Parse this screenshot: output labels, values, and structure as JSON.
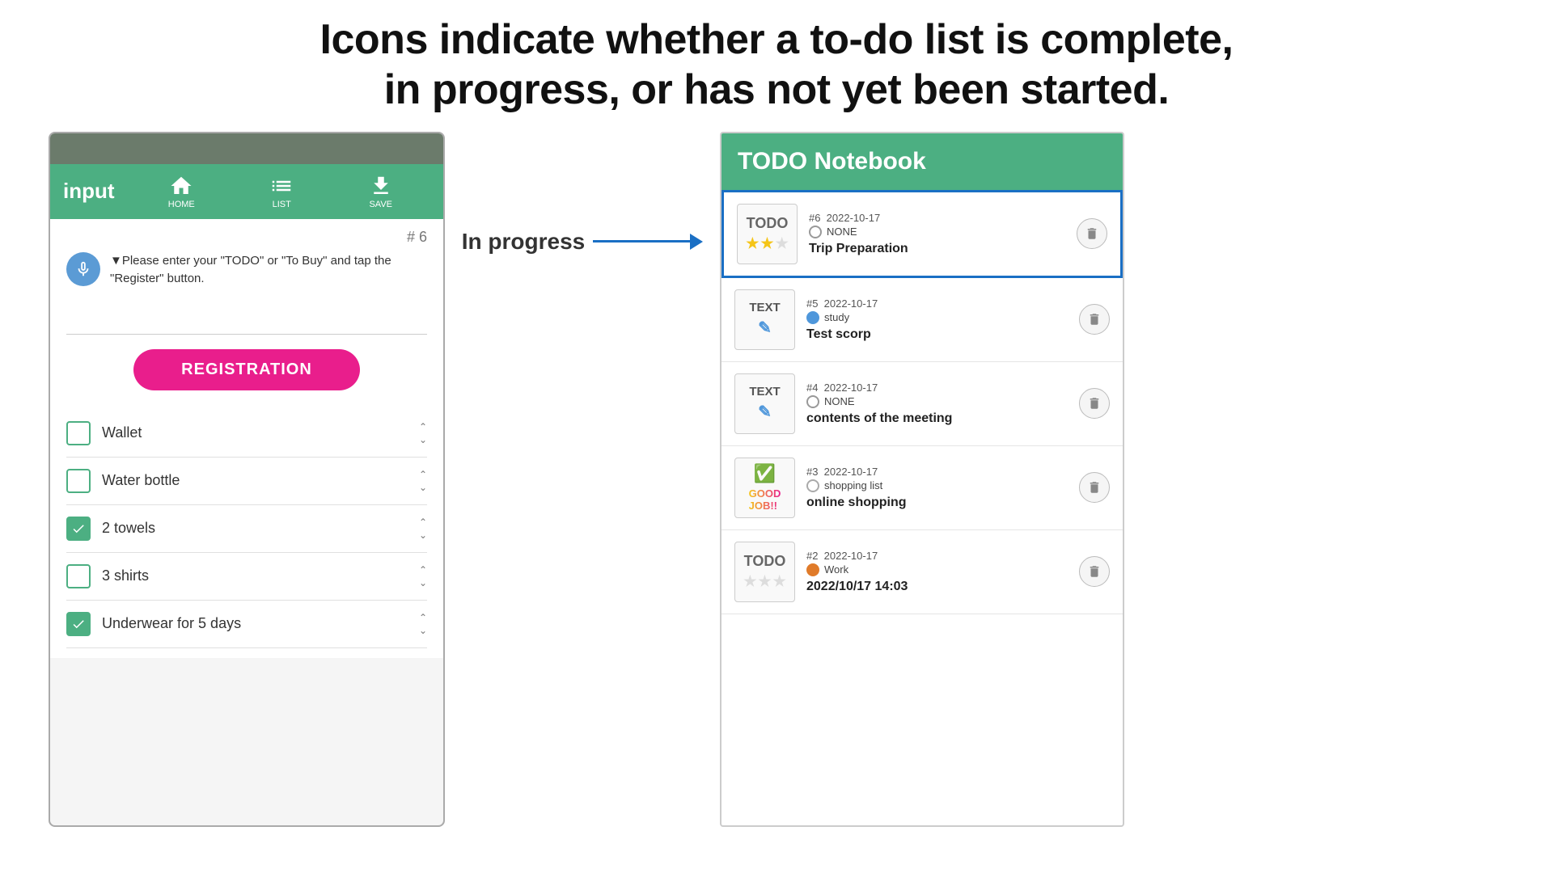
{
  "header": {
    "line1": "Icons indicate whether a to-do list is complete,",
    "line2": "in progress, or has not yet been started."
  },
  "mobile": {
    "input_label": "input",
    "nav": [
      {
        "icon": "home",
        "label": "HOME"
      },
      {
        "icon": "list",
        "label": "LIST"
      },
      {
        "icon": "save",
        "label": "SAVE"
      }
    ],
    "num": "# 6",
    "instruction": "▼Please enter your \"TODO\" or \"To Buy\" and tap the \"Register\" button.",
    "registration_btn": "REGISTRATION",
    "checklist": [
      {
        "label": "Wallet",
        "checked": false
      },
      {
        "label": "Water bottle",
        "checked": false
      },
      {
        "label": "2 towels",
        "checked": true
      },
      {
        "label": "3 shirts",
        "checked": false
      },
      {
        "label": "Underwear for 5 days",
        "checked": true
      }
    ]
  },
  "arrow": {
    "label": "In progress"
  },
  "todo": {
    "title": "TODO Notebook",
    "items": [
      {
        "id": 6,
        "date": "2022-10-17",
        "thumb_type": "todo_stars",
        "stars": [
          true,
          false,
          false
        ],
        "tag_color": "none",
        "tag": "NONE",
        "title": "Trip Preparation",
        "highlighted": true
      },
      {
        "id": 5,
        "date": "2022-10-17",
        "thumb_type": "text",
        "tag_color": "blue",
        "tag": "study",
        "title": "Test scorp",
        "highlighted": false
      },
      {
        "id": 4,
        "date": "2022-10-17",
        "thumb_type": "text",
        "tag_color": "none",
        "tag": "NONE",
        "title": "contents of the meeting",
        "highlighted": false
      },
      {
        "id": 3,
        "date": "2022-10-17",
        "thumb_type": "check_goodjob",
        "tag_color": "none",
        "tag": "shopping list",
        "title": "online shopping",
        "highlighted": false
      },
      {
        "id": 2,
        "date": "2022-10-17",
        "thumb_type": "todo_empty_stars",
        "stars": [
          false,
          false,
          false
        ],
        "tag_color": "orange",
        "tag": "Work",
        "title": "2022/10/17 14:03",
        "highlighted": false
      }
    ]
  }
}
